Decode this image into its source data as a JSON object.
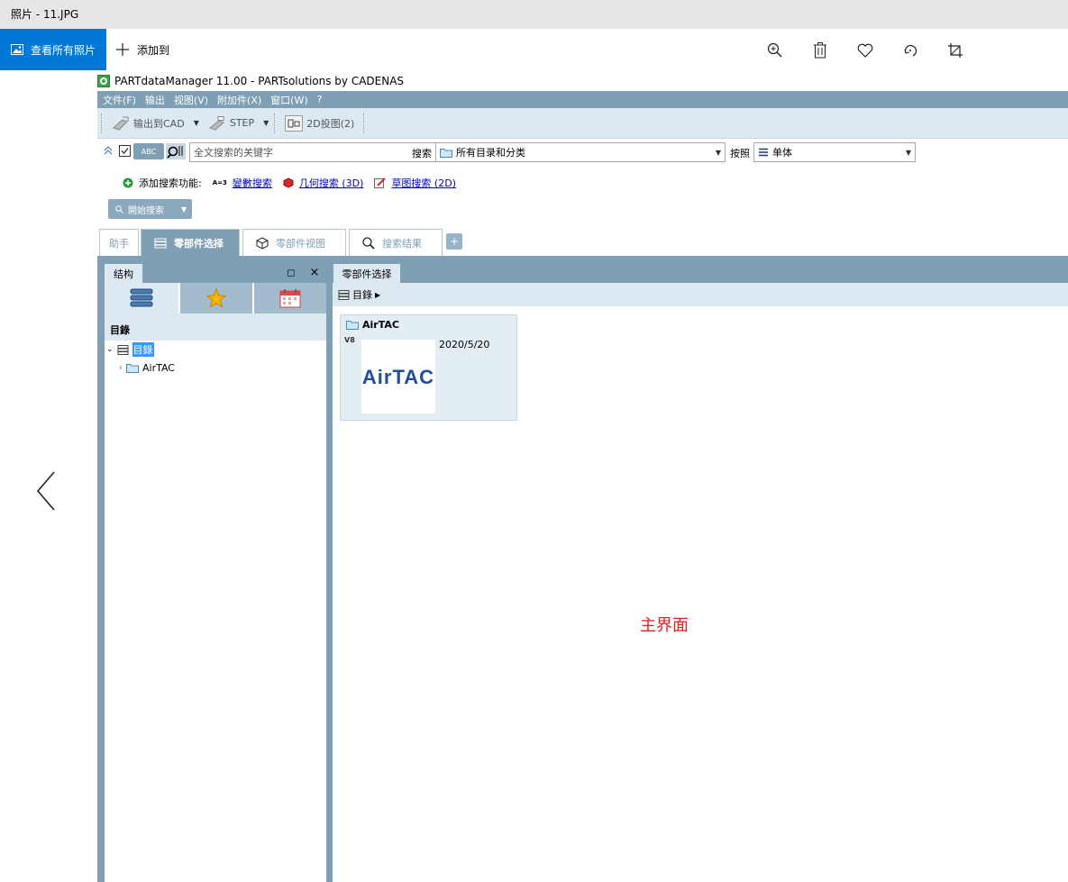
{
  "window": {
    "title": "照片 - 11.JPG"
  },
  "photos_toolbar": {
    "view_all": "查看所有照片",
    "add_to": "添加到",
    "icons": [
      "zoom-in-icon",
      "trash-icon",
      "heart-icon",
      "rotate-icon",
      "crop-icon"
    ]
  },
  "app": {
    "title": "PARTdataManager 11.00 - PARTsolutions by CADENAS",
    "menu": [
      "文件(F)",
      "输出",
      "视图(V)",
      "附加件(X)",
      "窗口(W)",
      "?"
    ],
    "toolbar": {
      "export_cad": "输出到CAD",
      "step": "STEP",
      "projection": "2D投图(2)"
    },
    "search": {
      "abc_toggle": "ABC",
      "input_placeholder": "全文搜索的关键字",
      "search_label": "搜索",
      "catalog_value": "所有目录和分类",
      "by_label": "按照",
      "by_value": "单体"
    },
    "add_search": {
      "label": "添加搜索功能:",
      "param_prefix": "A=3",
      "param": "變數搜索",
      "geometry": "几何搜索 (3D)",
      "sketch": "草图搜索 (2D)"
    },
    "start_search": "開始搜索",
    "tabs": [
      "助手",
      "零部件选择",
      "零部件视图",
      "搜索结果"
    ],
    "tab_add": "+",
    "left_panel": {
      "tab": "结构",
      "restore": "◻",
      "close": "×",
      "tree_title": "目錄",
      "tree": [
        {
          "label": "目錄",
          "expanded": true,
          "selected": true
        },
        {
          "label": "AirTAC",
          "expanded": false
        }
      ]
    },
    "right_panel": {
      "tab": "零部件选择",
      "breadcrumb": "目錄",
      "card": {
        "title": "AirTAC",
        "version": "V8",
        "date": "2020/5/20",
        "logo": "AirTAC"
      }
    },
    "annotation": "主界面"
  },
  "colors": {
    "accent": "#0078d7",
    "app_frame": "#7e9fb4",
    "pane_bg": "#dde9f1",
    "annotation": "#e02020"
  }
}
